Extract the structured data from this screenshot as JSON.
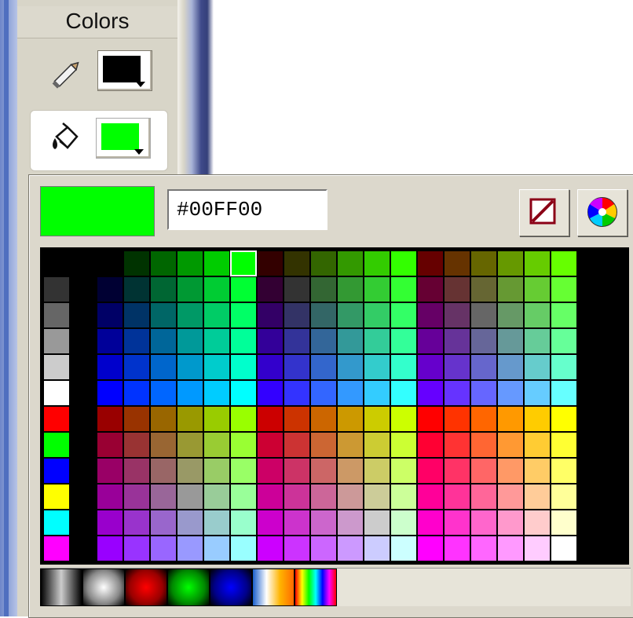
{
  "panel": {
    "title": "Colors"
  },
  "stroke": {
    "color": "#000000",
    "icon": "pencil-icon"
  },
  "fill": {
    "color": "#00FF00",
    "icon": "paint-bucket-icon"
  },
  "popup": {
    "hex_value": "#00FF00",
    "preview_color": "#00FF00",
    "buttons": {
      "no_color": "no-color-icon",
      "color_mixer": "color-wheel-icon"
    }
  },
  "palette": {
    "selected": "#00FF00",
    "left_column": [
      "#000000",
      "#333333",
      "#666666",
      "#999999",
      "#CCCCCC",
      "#FFFFFF",
      "#FF0000",
      "#00FF00",
      "#0000FF",
      "#FFFF00",
      "#00FFFF",
      "#FF00FF"
    ],
    "grid_base": {
      "note_rows": 12,
      "note_cols": 18
    },
    "gradients": [
      "grey-radial",
      "white-radial",
      "red-radial",
      "green-radial",
      "blue-radial",
      "blue-white-orange",
      "rainbow"
    ]
  }
}
